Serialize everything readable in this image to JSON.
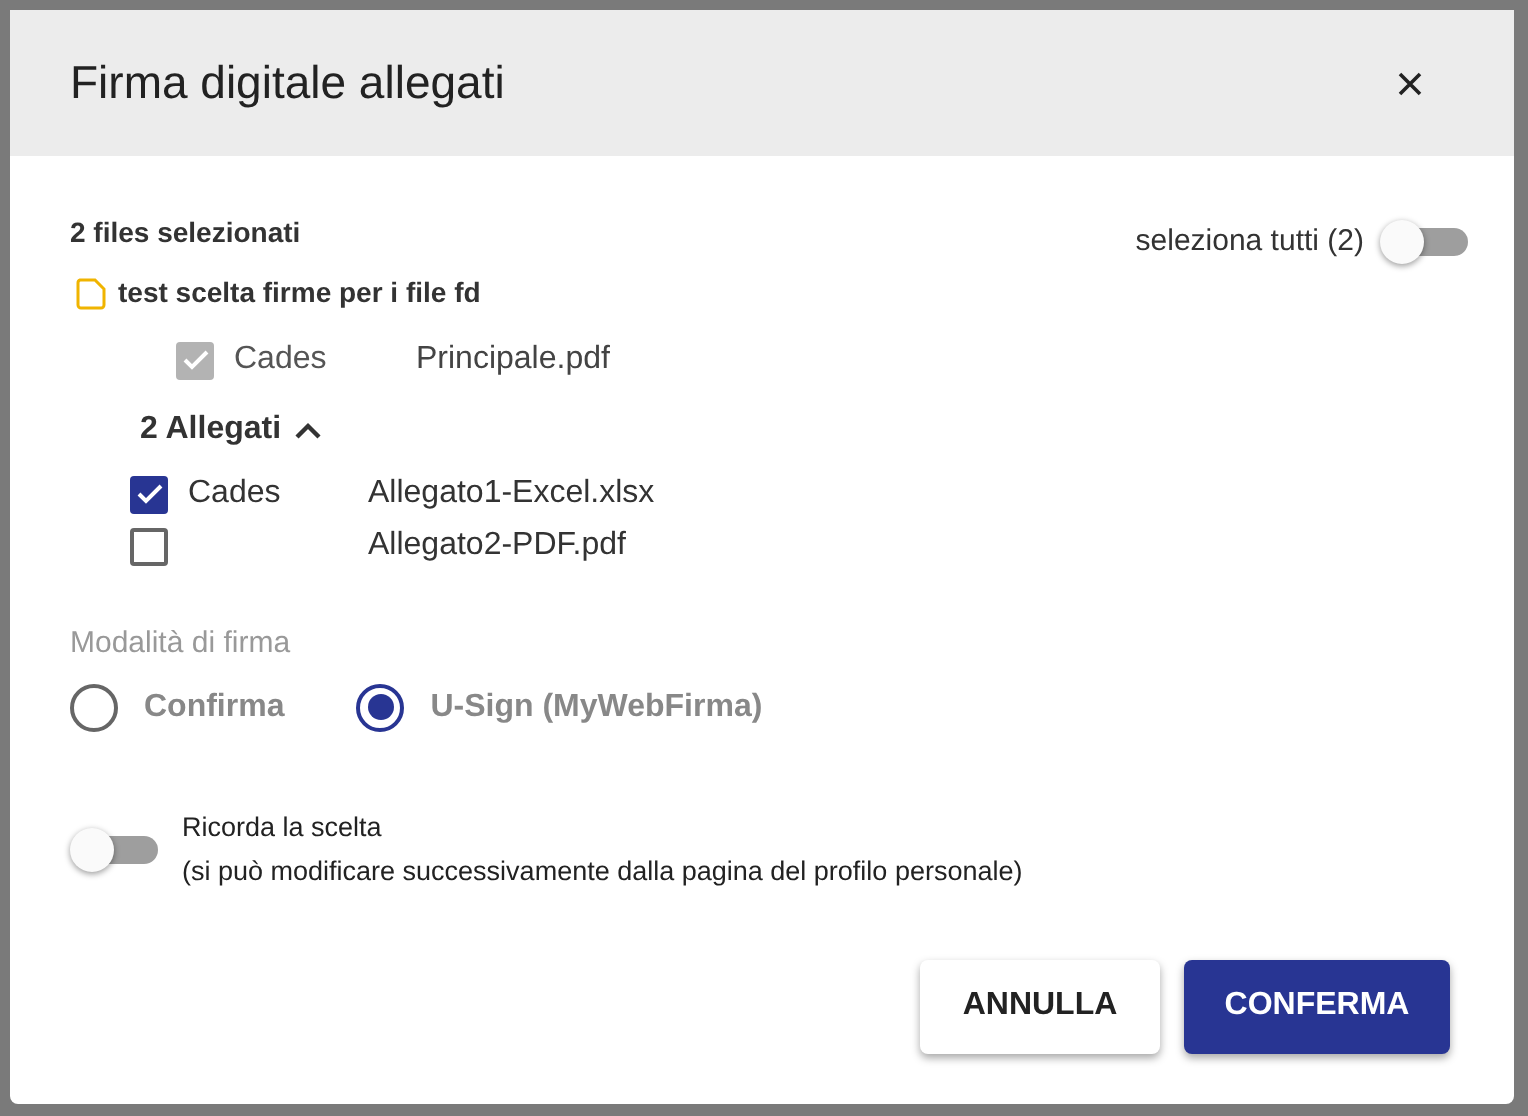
{
  "dialog": {
    "title": "Firma digitale allegati"
  },
  "selection_summary": "2 files selezionati",
  "select_all": {
    "label": "seleziona tutti (2)",
    "on": false
  },
  "document": {
    "name": "test scelta firme per i file fd",
    "main_file": {
      "checked": true,
      "disabled": true,
      "signature": "Cades",
      "name": "Principale.pdf"
    },
    "attachments": {
      "label": "2 Allegati",
      "expanded": true,
      "items": [
        {
          "checked": true,
          "signature": "Cades",
          "name": "Allegato1-Excel.xlsx"
        },
        {
          "checked": false,
          "name": "Allegato2-PDF.pdf"
        }
      ]
    }
  },
  "signature_mode": {
    "label": "Modalità di firma",
    "disabled": true,
    "options": [
      {
        "label": "Confirma",
        "selected": false
      },
      {
        "label": "U-Sign (MyWebFirma)",
        "selected": true
      }
    ]
  },
  "remember": {
    "label": "Ricorda la scelta",
    "note": "(si può modificare successivamente dalla pagina del profilo personale)",
    "on": false
  },
  "buttons": [
    {
      "label": "ANNULLA",
      "kind": "secondary"
    },
    {
      "label": "CONFERMA",
      "kind": "primary"
    }
  ]
}
